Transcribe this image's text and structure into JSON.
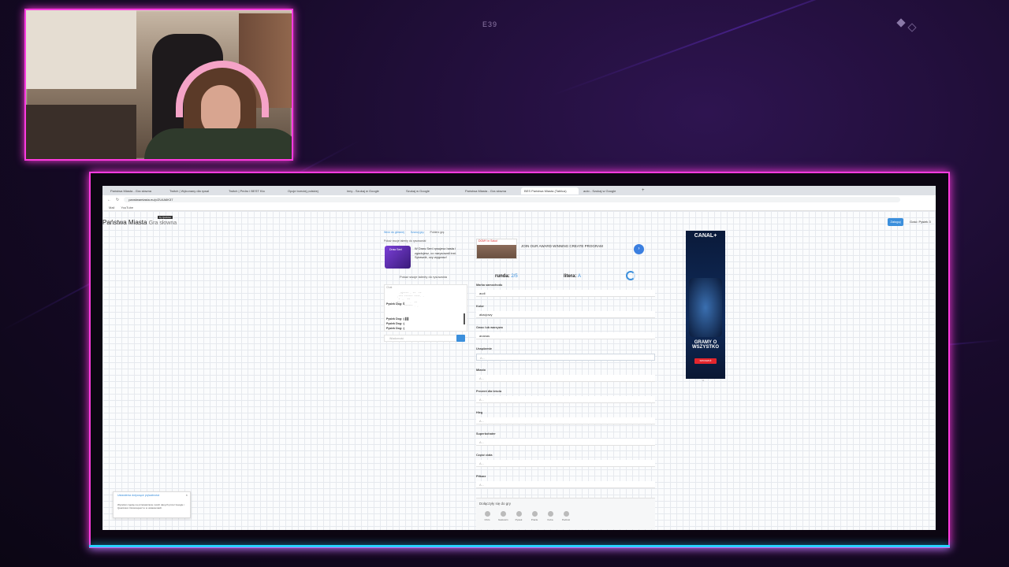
{
  "overlay": {
    "scene_code": "E39"
  },
  "browser": {
    "tabs": [
      {
        "label": "Państwa Miasta - Gra słowna"
      },
      {
        "label": "Twitch | Wykonany dla rywal"
      },
      {
        "label": "Twitch | Pedro i BEST Kto"
      },
      {
        "label": "Opcje trzeciej polskiej"
      },
      {
        "label": "inny - Szukaj w Google"
      },
      {
        "label": "Szukaj w Google"
      },
      {
        "label": "Państwa Miasta - Gra słowna"
      },
      {
        "label": "BES Państwa Miasta (Tablica)"
      },
      {
        "label": "auto - Szukaj w Google"
      }
    ],
    "url": "panstwamiasta.eu/p/ZU4A6K37",
    "bookmarks": [
      "Mail",
      "YouTube"
    ]
  },
  "site": {
    "title": "Państwa Miasta",
    "subtitle": "Gra słowna",
    "badge": "by Quizzeo",
    "login_label": "Zaloguj",
    "guest_label": "Gość: Pysiek 3"
  },
  "sidebar": {
    "links": [
      "Wróć do głównej",
      "Szanuj grę",
      "Pobierz grę"
    ],
    "promo_heading": "Pokaż swoje talenty do rysowania!",
    "promo_image_label": "Draw Sen!",
    "promo_text": "W Draw Sen! rysujesz hasła i zgadujesz, co narysowali inni. Sprawdź, czy wygrasz!",
    "promo_link": "Pokaż swoje talenty do rysowania",
    "chat_title": "Chat",
    "chat_scramble": "  .!Ś**** - **  **\n ,*** ****** ****. -\n  * ..  **\n F*  '    .  **\n *',  ****** . ,",
    "chat_messages": [
      "Pysiek Dog: Ś",
      "Pysiek Dog: :) ▌▌",
      "Pysiek Dog: :)",
      "Pysiek Dog: :)"
    ],
    "chat_placeholder": "Wiadomość"
  },
  "game": {
    "ad": {
      "badge": "DOMY in Szkoł",
      "text": "JOIN OUR AWARD WINNING CREATE PROGRAM",
      "button_icon": "›"
    },
    "round_label": "runda:",
    "round_value": "2/5",
    "letter_label": "litera:",
    "letter_value": "A",
    "fields": [
      {
        "label": "Marka samochodu",
        "value": "audi",
        "placeholder": ""
      },
      {
        "label": "Kolor",
        "value": "akacjowy",
        "placeholder": ""
      },
      {
        "label": "Owoc lub warzywo",
        "value": "ananas",
        "placeholder": ""
      },
      {
        "label": "Urządzenie",
        "value": "",
        "placeholder": "A..."
      },
      {
        "label": "Miasto",
        "value": "",
        "placeholder": "A..."
      },
      {
        "label": "Prezent dla teścia",
        "value": "",
        "placeholder": "A..."
      },
      {
        "label": "Hieg",
        "value": "",
        "placeholder": "A..."
      },
      {
        "label": "Superbohater",
        "value": "",
        "placeholder": "A..."
      },
      {
        "label": "Część ciała",
        "value": "",
        "placeholder": "A..."
      },
      {
        "label": "Piłkarz",
        "value": "",
        "placeholder": "A..."
      }
    ],
    "players_heading": "Dołączyły się do gry",
    "players": [
      "Chris",
      "Gastowin",
      "Pysiek",
      "Pracle",
      "Kuba",
      "Pedrusi"
    ]
  },
  "right_ad": {
    "brand": "CANAL+",
    "slogan": "GRAMY O WSZYSTKO",
    "cta": "SPRAWDŹ"
  },
  "consent": {
    "heading": "Ustawienia dotyczące prywatności",
    "body": "Wyrażam zgodę na przetwarzanie moich danych przez Google i Quantcast. Dostosujesz to w ustawieniach."
  }
}
